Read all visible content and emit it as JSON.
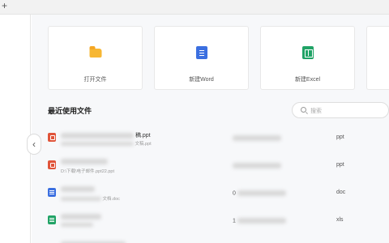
{
  "titlebar": {
    "new_tab_symbol": "+"
  },
  "sidebar": {
    "collapse_symbol": "‹"
  },
  "quick_actions": [
    {
      "label": "打开文件",
      "icon": "folder-icon"
    },
    {
      "label": "新建Word",
      "icon": "word-doc-icon"
    },
    {
      "label": "新建Excel",
      "icon": "excel-sheet-icon"
    }
  ],
  "recent": {
    "title": "最近使用文件",
    "search_placeholder": "搜索",
    "files": [
      {
        "name_visible": "稿.ppt",
        "path_visible": "文稿.ppt",
        "time_visible": "",
        "type": "ppt",
        "icon": "ppt-file-icon"
      },
      {
        "name_visible": "",
        "path_visible": "D:\\下载\\电子邮件.ppt22.ppt",
        "time_visible": "",
        "type": "ppt",
        "icon": "ppt-file-icon"
      },
      {
        "name_visible": "",
        "path_visible": "文档.doc",
        "time_visible": "0",
        "type": "doc",
        "icon": "doc-file-icon"
      },
      {
        "name_visible": "",
        "path_visible": "",
        "time_visible": "1",
        "type": "xls",
        "icon": "xls-file-icon"
      }
    ]
  },
  "colors": {
    "accent_blue": "#3b6fe0",
    "excel_green": "#21a366",
    "ppt_red": "#e0543a",
    "folder_yellow": "#f7b733"
  }
}
